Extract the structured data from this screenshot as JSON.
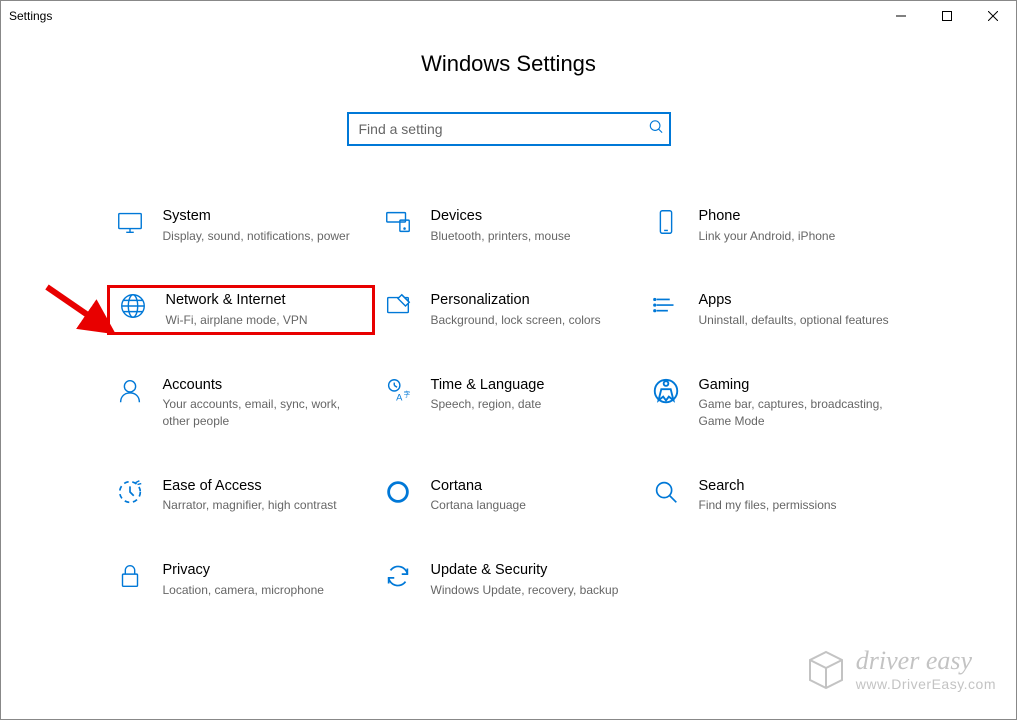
{
  "window": {
    "title": "Settings"
  },
  "page": {
    "heading": "Windows Settings"
  },
  "search": {
    "placeholder": "Find a setting"
  },
  "categories": [
    {
      "id": "system",
      "title": "System",
      "desc": "Display, sound, notifications, power"
    },
    {
      "id": "devices",
      "title": "Devices",
      "desc": "Bluetooth, printers, mouse"
    },
    {
      "id": "phone",
      "title": "Phone",
      "desc": "Link your Android, iPhone"
    },
    {
      "id": "network",
      "title": "Network & Internet",
      "desc": "Wi-Fi, airplane mode, VPN",
      "highlight": true
    },
    {
      "id": "personalization",
      "title": "Personalization",
      "desc": "Background, lock screen, colors"
    },
    {
      "id": "apps",
      "title": "Apps",
      "desc": "Uninstall, defaults, optional features"
    },
    {
      "id": "accounts",
      "title": "Accounts",
      "desc": "Your accounts, email, sync, work, other people"
    },
    {
      "id": "time",
      "title": "Time & Language",
      "desc": "Speech, region, date"
    },
    {
      "id": "gaming",
      "title": "Gaming",
      "desc": "Game bar, captures, broadcasting, Game Mode"
    },
    {
      "id": "ease",
      "title": "Ease of Access",
      "desc": "Narrator, magnifier, high contrast"
    },
    {
      "id": "cortana",
      "title": "Cortana",
      "desc": "Cortana language"
    },
    {
      "id": "search",
      "title": "Search",
      "desc": "Find my files, permissions"
    },
    {
      "id": "privacy",
      "title": "Privacy",
      "desc": "Location, camera, microphone"
    },
    {
      "id": "update",
      "title": "Update & Security",
      "desc": "Windows Update, recovery, backup"
    }
  ],
  "watermark": {
    "brand": "driver easy",
    "url": "www.DriverEasy.com"
  }
}
